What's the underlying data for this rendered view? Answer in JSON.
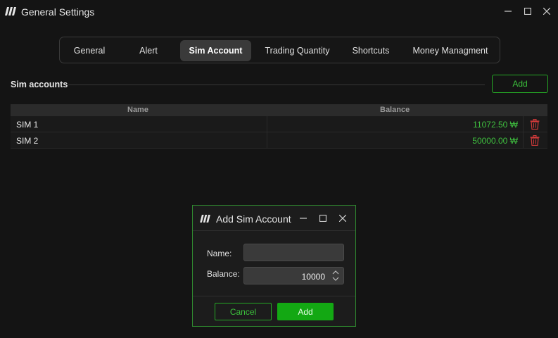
{
  "window": {
    "title": "General Settings",
    "icons": {
      "logo": "app-logo-icon",
      "minimize": "minimize-icon",
      "maximize": "maximize-icon",
      "close": "close-icon"
    }
  },
  "tabs": [
    {
      "label": "General",
      "active": false
    },
    {
      "label": "Alert",
      "active": false
    },
    {
      "label": "Sim Account",
      "active": true
    },
    {
      "label": "Trading Quantity",
      "active": false
    },
    {
      "label": "Shortcuts",
      "active": false
    },
    {
      "label": "Money Managment",
      "active": false
    }
  ],
  "section": {
    "title": "Sim accounts",
    "add_label": "Add"
  },
  "table": {
    "columns": [
      "Name",
      "Balance"
    ],
    "rows": [
      {
        "name": "SIM 1",
        "balance": "11072.50 ₩"
      },
      {
        "name": "SIM 2",
        "balance": "50000.00 ₩"
      }
    ]
  },
  "dialog": {
    "title": "Add Sim Account",
    "name_label": "Name:",
    "name_value": "",
    "balance_label": "Balance:",
    "balance_value": "10000",
    "cancel_label": "Cancel",
    "ok_label": "Add"
  },
  "colors": {
    "accent": "#13a813",
    "accent_text": "#3cc23c",
    "delete": "#d03a3a",
    "background": "#141414"
  }
}
